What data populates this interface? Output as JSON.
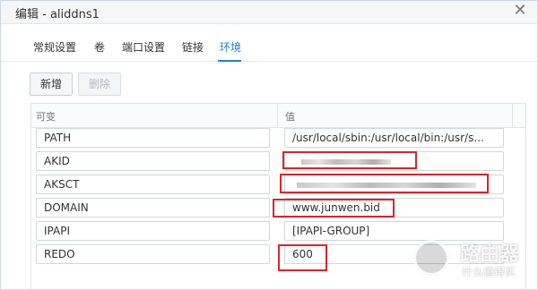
{
  "dialog": {
    "title": "编辑 - aliddns1",
    "close_glyph": "✕"
  },
  "tabs": [
    {
      "label": "常规设置"
    },
    {
      "label": "卷"
    },
    {
      "label": "端口设置"
    },
    {
      "label": "链接"
    },
    {
      "label": "环境",
      "active": true
    }
  ],
  "toolbar": {
    "add_label": "新增",
    "delete_label": "删除"
  },
  "table": {
    "col_variable": "可变",
    "col_value": "值",
    "rows": [
      {
        "key": "PATH",
        "value": "/usr/local/sbin:/usr/local/bin:/usr/s..."
      },
      {
        "key": "AKID",
        "value": "",
        "redacted": true
      },
      {
        "key": "AKSCT",
        "value": "",
        "redacted": true
      },
      {
        "key": "DOMAIN",
        "value": "www.junwen.bid"
      },
      {
        "key": "IPAPI",
        "value": "[IPAPI-GROUP]"
      },
      {
        "key": "REDO",
        "value": "600"
      }
    ]
  },
  "watermark": {
    "brand": "路由器",
    "sub": "什么值得买"
  },
  "colors": {
    "accent": "#1f7fd6",
    "highlight": "#d9252b"
  }
}
